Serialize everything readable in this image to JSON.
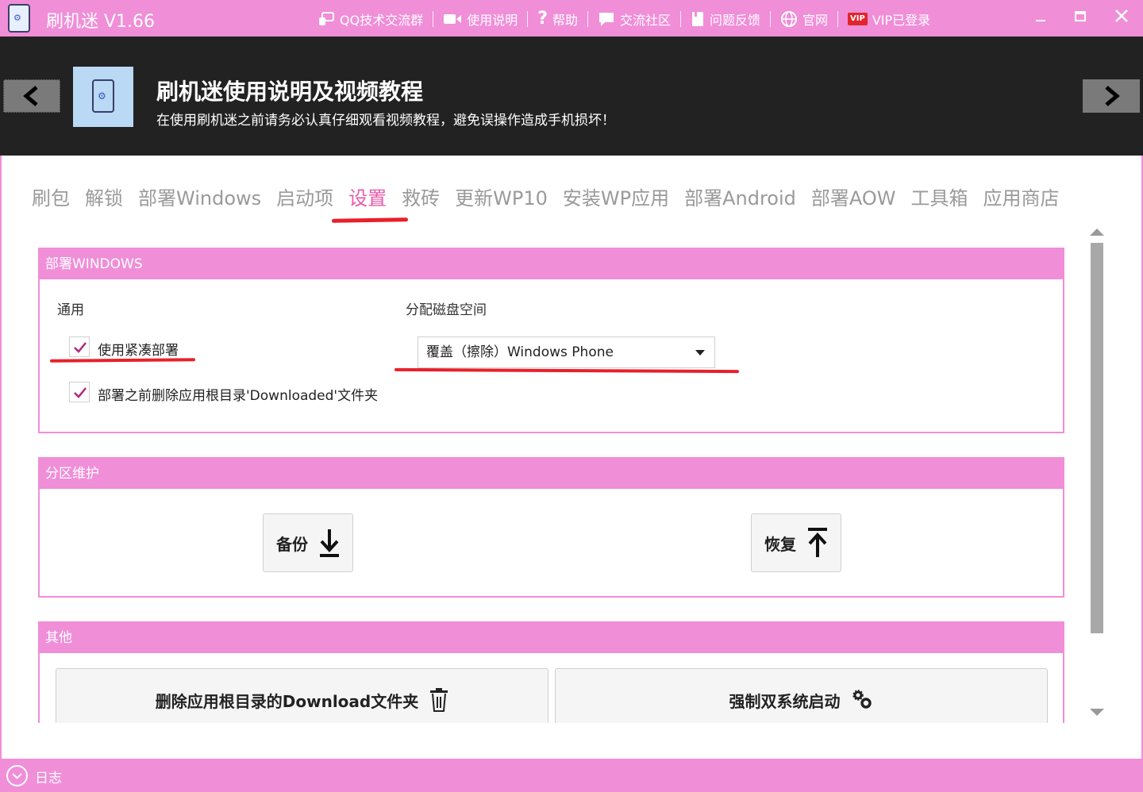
{
  "app": {
    "title": "刷机迷 V1.66"
  },
  "toplinks": [
    {
      "label": "QQ技术交流群",
      "icon": "qq-group-icon"
    },
    {
      "label": "使用说明",
      "icon": "video-camera-icon"
    },
    {
      "label": "帮助",
      "icon": "question-icon"
    },
    {
      "label": "交流社区",
      "icon": "chat-bubble-icon"
    },
    {
      "label": "问题反馈",
      "icon": "feedback-icon"
    },
    {
      "label": "官网",
      "icon": "globe-icon"
    },
    {
      "label": "VIP已登录",
      "icon": "vip-badge-icon",
      "badge": "VIP"
    }
  ],
  "banner": {
    "title": "刷机迷使用说明及视频教程",
    "subtitle": "在使用刷机迷之前请务必认真仔细观看视频教程，避免误操作造成手机损坏！"
  },
  "tabs": [
    {
      "label": "刷包"
    },
    {
      "label": "解锁"
    },
    {
      "label": "部署Windows"
    },
    {
      "label": "启动项"
    },
    {
      "label": "设置",
      "active": true
    },
    {
      "label": "救砖"
    },
    {
      "label": "更新WP10"
    },
    {
      "label": "安装WP应用"
    },
    {
      "label": "部署Android"
    },
    {
      "label": "部署AOW"
    },
    {
      "label": "工具箱"
    },
    {
      "label": "应用商店"
    }
  ],
  "deploy_windows": {
    "header": "部署WINDOWS",
    "general_label": "通用",
    "compact_label": "使用紧凑部署",
    "compact_checked": true,
    "delete_downloaded_label": "部署之前删除应用根目录'Downloaded'文件夹",
    "delete_downloaded_checked": true,
    "disk_label": "分配磁盘空间",
    "disk_value": "覆盖（擦除）Windows Phone"
  },
  "partition": {
    "header": "分区维护",
    "backup_label": "备份",
    "restore_label": "恢复"
  },
  "other": {
    "header": "其他",
    "delete_download_label": "删除应用根目录的Download文件夹",
    "force_dual_label": "强制双系统启动"
  },
  "log": {
    "label": "日志"
  },
  "colors": {
    "accent": "#f08ed8",
    "active_tab": "#e85aa8",
    "annotation": "#e8202a",
    "banner": "#222222"
  }
}
